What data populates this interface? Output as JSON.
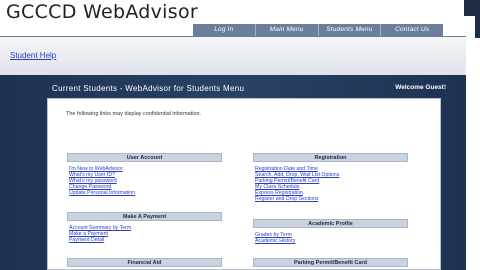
{
  "app": {
    "title": "GCCCD WebAdvisor"
  },
  "topnav": [
    "Log In",
    "Main Menu",
    "Students Menu",
    "Contact Us"
  ],
  "help": {
    "label": "Student Help"
  },
  "menu": {
    "title": "Current Students - WebAdvisor for Students Menu",
    "welcome": "Welcome Guest!",
    "notice": "The following links may display confidential information."
  },
  "sections": {
    "user_account": {
      "title": "User Account",
      "links": [
        "I'm New to WebAdvisor",
        "What's my User ID?",
        "What's my password",
        "Change Password",
        "Update Personal Information"
      ]
    },
    "make_payment": {
      "title": "Make A Payment",
      "links": [
        "Account Summary by Term",
        "Make a Payment",
        "Payment Detail"
      ]
    },
    "financial_aid": {
      "title": "Financial Aid",
      "links": []
    },
    "registration": {
      "title": "Registration",
      "links": [
        "Registration Date and Time",
        "Search, Add, Drop, Wait List Options",
        "Parking Permit/Benefit Card",
        "My Class Schedule",
        "Express Registration",
        "Register and Drop Sections"
      ]
    },
    "academic_profile": {
      "title": "Academic Profile",
      "links": [
        "Grades by Term",
        "Academic History"
      ]
    },
    "parking": {
      "title": "Parking Permit/Benefit Card",
      "links": []
    }
  }
}
